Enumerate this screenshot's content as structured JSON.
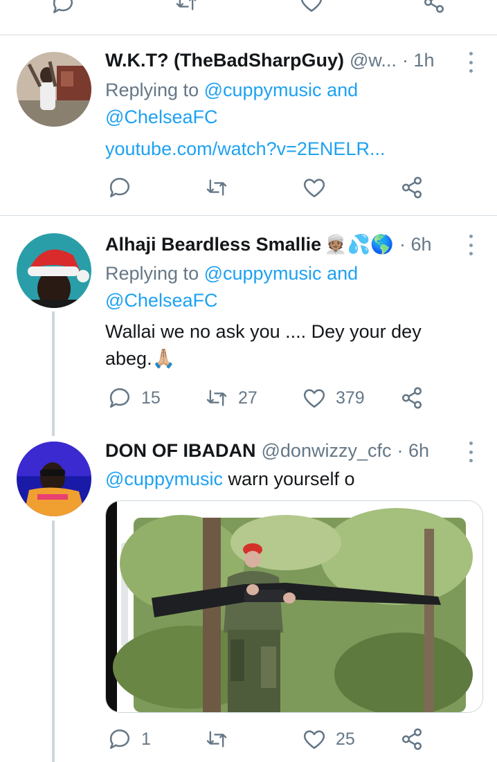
{
  "tweets": [
    {
      "name": "W.K.T? (TheBadSharpGuy)",
      "handle": "@w...",
      "time": "· 1h",
      "reply_prefix": "Replying to ",
      "reply_to_1": "@cuppymusic",
      "reply_and": " and",
      "reply_to_2": "@ChelseaFC",
      "link": "youtube.com/watch?v=2ENELR..."
    },
    {
      "name": "Alhaji Beardless Smallie",
      "emoji": "👳🏽💦🌎",
      "time": "· 6h",
      "reply_prefix": "Replying to ",
      "reply_to_1": "@cuppymusic",
      "reply_and": " and",
      "reply_to_2": "@ChelseaFC",
      "text_line1": "Wallai we no ask you .... Dey your dey",
      "text_line2": "abeg.🙏🏼",
      "replies": "15",
      "retweets": "27",
      "likes": "379"
    },
    {
      "name": "DON OF IBADAN",
      "handle": "@donwizzy_cfc",
      "time": "· 6h",
      "mention": "@cuppymusic",
      "text": " warn yourself o",
      "replies": "1",
      "likes": "25"
    }
  ],
  "colors": {
    "link": "#1da1f2",
    "muted": "#657786",
    "divider": "#d6dde3",
    "thread": "#ccd6dd"
  }
}
